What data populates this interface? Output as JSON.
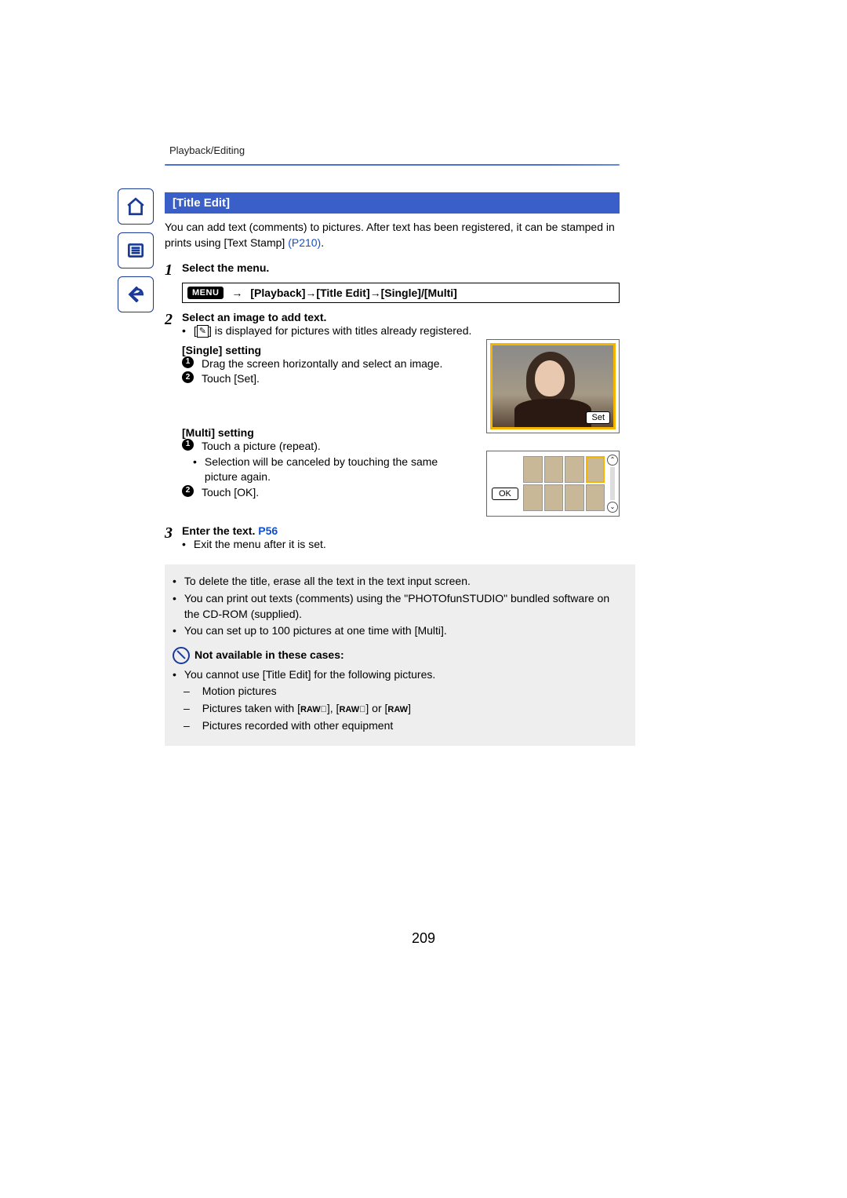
{
  "breadcrumb": "Playback/Editing",
  "section_title": "[Title Edit]",
  "intro_a": "You can add text (comments) to pictures. After text has been registered, it can be stamped in prints using [Text Stamp] ",
  "intro_link": "(P210)",
  "intro_b": ".",
  "steps": {
    "s1_num": "1",
    "s1_title": "Select the menu.",
    "menu_chip": "MENU",
    "menu_arrow": "→",
    "menu_path": "[Playback]→[Title Edit]→[Single]/[Multi]",
    "s2_num": "2",
    "s2_title": "Select an image to add text.",
    "s2_note_a": "[",
    "s2_note_icon": "✎",
    "s2_note_b": "] is displayed for pictures with titles already registered.",
    "single_head": "[Single] setting",
    "single_1": "Drag the screen horizontally and select an image.",
    "single_2": "Touch [Set].",
    "multi_head": "[Multi] setting",
    "multi_1": "Touch a picture (repeat).",
    "multi_1_sub": "Selection will be canceled by touching the same picture again.",
    "multi_2": "Touch [OK].",
    "s3_num": "3",
    "s3_title": "Enter the text. ",
    "s3_link": "P56",
    "s3_note": "Exit the menu after it is set."
  },
  "ui": {
    "set_label": "Set",
    "ok_label": "OK",
    "scroll_up": "⌃",
    "scroll_down": "⌄"
  },
  "notes": {
    "n1": "To delete the title, erase all the text in the text input screen.",
    "n2": "You can print out texts (comments) using the \"PHOTOfunSTUDIO\" bundled software on the CD-ROM (supplied).",
    "n3": "You can set up to 100 pictures at one time with [Multi].",
    "na_title": "Not available in these cases:",
    "na_lead": "You cannot use [Title Edit] for the following pictures.",
    "na_a": "Motion pictures",
    "na_b_pre": "Pictures taken with [",
    "na_b_r1": "RAW􀂇",
    "na_b_mid1": "], [",
    "na_b_r2": "RAW􀂈",
    "na_b_mid2": "] or [",
    "na_b_r3": "RAW",
    "na_b_post": "]",
    "na_c": "Pictures recorded with other equipment"
  },
  "page_number": "209"
}
